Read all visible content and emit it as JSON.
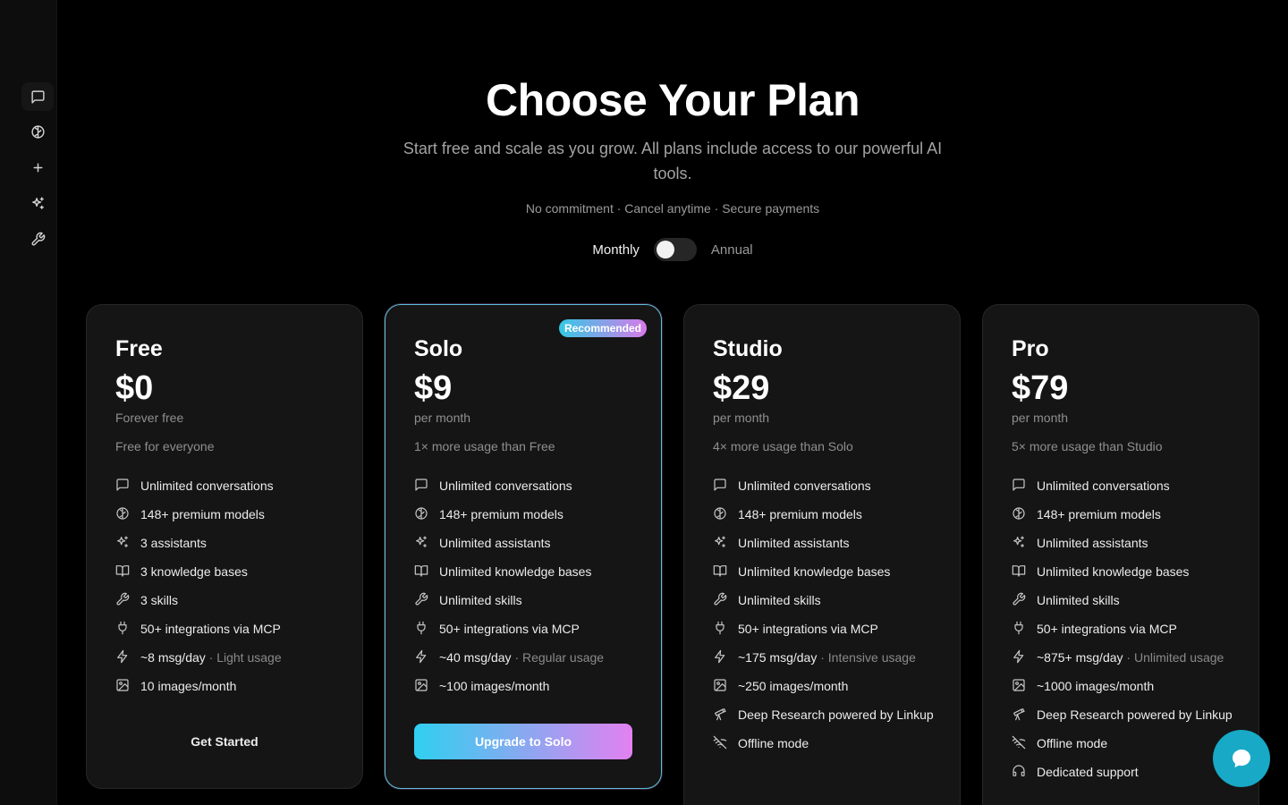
{
  "sidebar": {
    "items": [
      {
        "name": "chat-icon",
        "active": true
      },
      {
        "name": "models-icon"
      },
      {
        "name": "plus-icon"
      },
      {
        "name": "sparkles-icon"
      },
      {
        "name": "wrench-icon"
      }
    ]
  },
  "header": {
    "title": "Choose Your Plan",
    "subtitle": "Start free and scale as you grow. All plans include access to our powerful AI tools.",
    "assurances": "No commitment · Cancel anytime · Secure payments"
  },
  "billing": {
    "monthly_label": "Monthly",
    "annual_label": "Annual",
    "selected": "Monthly"
  },
  "plans": [
    {
      "name": "Free",
      "price": "$0",
      "period": "Forever free",
      "tagline": "Free for everyone",
      "features": [
        {
          "icon": "chat-icon",
          "text": "Unlimited conversations"
        },
        {
          "icon": "models-icon",
          "text": "148+ premium models"
        },
        {
          "icon": "sparkles-icon",
          "text": "3 assistants"
        },
        {
          "icon": "book-icon",
          "text": "3 knowledge bases"
        },
        {
          "icon": "wrench-icon",
          "text": "3 skills"
        },
        {
          "icon": "plug-icon",
          "text": "50+ integrations via MCP"
        },
        {
          "icon": "bolt-icon",
          "text": "~8 msg/day",
          "note": " · Light usage"
        },
        {
          "icon": "image-icon",
          "text": "10 images/month"
        }
      ],
      "cta": "Get Started"
    },
    {
      "name": "Solo",
      "price": "$9",
      "period": "per month",
      "tagline": "1× more usage than Free",
      "badge": "Recommended",
      "features": [
        {
          "icon": "chat-icon",
          "text": "Unlimited conversations"
        },
        {
          "icon": "models-icon",
          "text": "148+ premium models"
        },
        {
          "icon": "sparkles-icon",
          "text": "Unlimited assistants"
        },
        {
          "icon": "book-icon",
          "text": "Unlimited knowledge bases"
        },
        {
          "icon": "wrench-icon",
          "text": "Unlimited skills"
        },
        {
          "icon": "plug-icon",
          "text": "50+ integrations via MCP"
        },
        {
          "icon": "bolt-icon",
          "text": "~40 msg/day",
          "note": " · Regular usage"
        },
        {
          "icon": "image-icon",
          "text": "~100 images/month"
        }
      ],
      "cta": "Upgrade to Solo"
    },
    {
      "name": "Studio",
      "price": "$29",
      "period": "per month",
      "tagline": "4× more usage than Solo",
      "features": [
        {
          "icon": "chat-icon",
          "text": "Unlimited conversations"
        },
        {
          "icon": "models-icon",
          "text": "148+ premium models"
        },
        {
          "icon": "sparkles-icon",
          "text": "Unlimited assistants"
        },
        {
          "icon": "book-icon",
          "text": "Unlimited knowledge bases"
        },
        {
          "icon": "wrench-icon",
          "text": "Unlimited skills"
        },
        {
          "icon": "plug-icon",
          "text": "50+ integrations via MCP"
        },
        {
          "icon": "bolt-icon",
          "text": "~175 msg/day",
          "note": " · Intensive usage"
        },
        {
          "icon": "image-icon",
          "text": "~250 images/month"
        },
        {
          "icon": "telescope-icon",
          "text": "Deep Research powered by Linkup"
        },
        {
          "icon": "wifi-off-icon",
          "text": "Offline mode"
        }
      ]
    },
    {
      "name": "Pro",
      "price": "$79",
      "period": "per month",
      "tagline": "5× more usage than Studio",
      "features": [
        {
          "icon": "chat-icon",
          "text": "Unlimited conversations"
        },
        {
          "icon": "models-icon",
          "text": "148+ premium models"
        },
        {
          "icon": "sparkles-icon",
          "text": "Unlimited assistants"
        },
        {
          "icon": "book-icon",
          "text": "Unlimited knowledge bases"
        },
        {
          "icon": "wrench-icon",
          "text": "Unlimited skills"
        },
        {
          "icon": "plug-icon",
          "text": "50+ integrations via MCP"
        },
        {
          "icon": "bolt-icon",
          "text": "~875+ msg/day",
          "note": " · Unlimited usage"
        },
        {
          "icon": "image-icon",
          "text": "~1000 images/month"
        },
        {
          "icon": "telescope-icon",
          "text": "Deep Research powered by Linkup"
        },
        {
          "icon": "wifi-off-icon",
          "text": "Offline mode"
        },
        {
          "icon": "headset-icon",
          "text": "Dedicated support"
        }
      ]
    }
  ],
  "chat_fab": {
    "icon": "chat-bubble-icon"
  },
  "colors": {
    "background": "#000000",
    "card": "#151515",
    "card_border": "#262626",
    "accent_cyan": "#2fd0f0",
    "accent_pink": "#e281f0",
    "fab": "#18a9c6"
  }
}
